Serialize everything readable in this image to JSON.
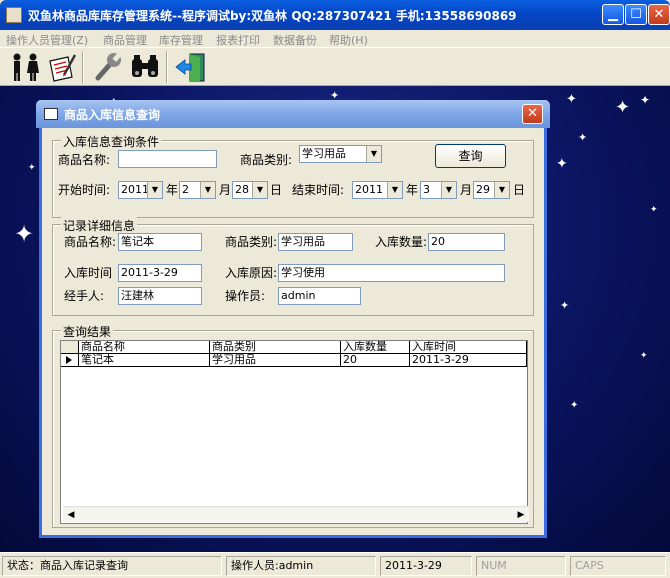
{
  "window": {
    "title": "双鱼林商品库库存管理系统--程序调试by:双鱼林 QQ:287307421 手机:13558690869",
    "min_glyph": "▁",
    "max_glyph": "☐",
    "close_glyph": "✕"
  },
  "menu": [
    "操作人员管理(Z)",
    "商品管理",
    "库存管理",
    "报表打印",
    "数据备份",
    "帮助(H)"
  ],
  "toolbar": {
    "icons": [
      "people-icon",
      "edit-document-icon",
      "wrench-icon",
      "binoculars-icon",
      "exit-door-icon"
    ]
  },
  "dialog": {
    "title": "商品入库信息查询",
    "close_glyph": "✕",
    "query": {
      "legend": "入库信息查询条件",
      "name_label": "商品名称:",
      "name_value": "",
      "category_label": "商品类别:",
      "category_value": "学习用品",
      "search_button": "查询",
      "start_label": "开始时间:",
      "start_year": "2011",
      "start_month": "2",
      "start_day": "28",
      "end_label": "结束时间:",
      "end_year": "2011",
      "end_month": "3",
      "end_day": "29",
      "year_unit": "年",
      "month_unit": "月",
      "day_unit": "日"
    },
    "detail": {
      "legend": "记录详细信息",
      "name_label": "商品名称:",
      "name_value": "笔记本",
      "category_label": "商品类别:",
      "category_value": "学习用品",
      "qty_label": "入库数量:",
      "qty_value": "20",
      "time_label": "入库时间",
      "time_value": "2011-3-29",
      "reason_label": "入库原因:",
      "reason_value": "学习使用",
      "handler_label": "经手人:",
      "handler_value": "汪建林",
      "operator_label": "操作员:",
      "operator_value": "admin"
    },
    "results": {
      "legend": "查询结果",
      "columns": [
        "商品名称",
        "商品类别",
        "入库数量",
        "入库时间"
      ],
      "rows": [
        [
          "笔记本",
          "学习用品",
          "20",
          "2011-3-29"
        ]
      ]
    }
  },
  "status": {
    "state": "状态：商品入库记录查询",
    "operator": "操作人员:admin",
    "date": "2011-3-29",
    "num": "NUM",
    "caps": "CAPS"
  }
}
